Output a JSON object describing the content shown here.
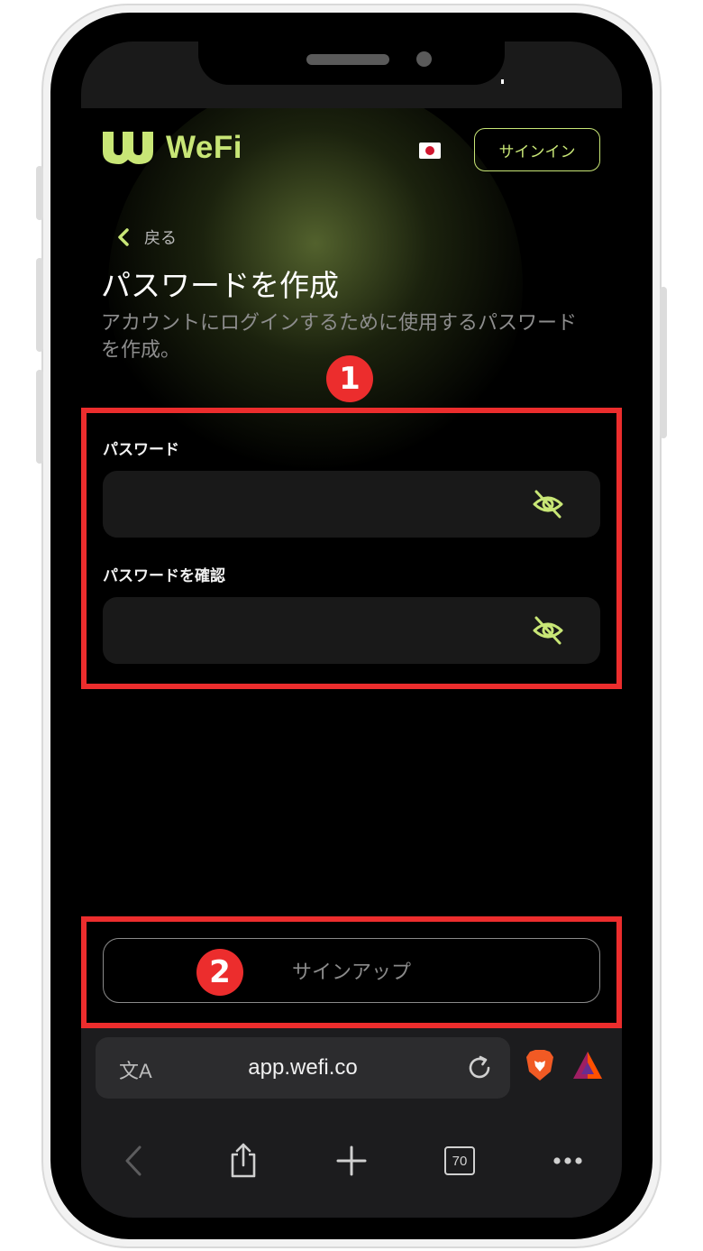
{
  "header": {
    "logo_text": "WeFi",
    "signin_label": "サインイン"
  },
  "page": {
    "back_label": "戻る",
    "title": "パスワードを作成",
    "subtitle": "アカウントにログインするために使用するパスワードを作成。"
  },
  "form": {
    "password_label": "パスワード",
    "password_value": "",
    "confirm_label": "パスワードを確認",
    "confirm_value": ""
  },
  "signup_label": "サインアップ",
  "browser": {
    "url": "app.wefi.co",
    "tab_count": "70",
    "translate_glyph": "文A"
  },
  "annotations": {
    "one": "1",
    "two": "2"
  },
  "colors": {
    "accent": "#c8e676",
    "annotation": "#ec2d2d",
    "background": "#000000"
  }
}
